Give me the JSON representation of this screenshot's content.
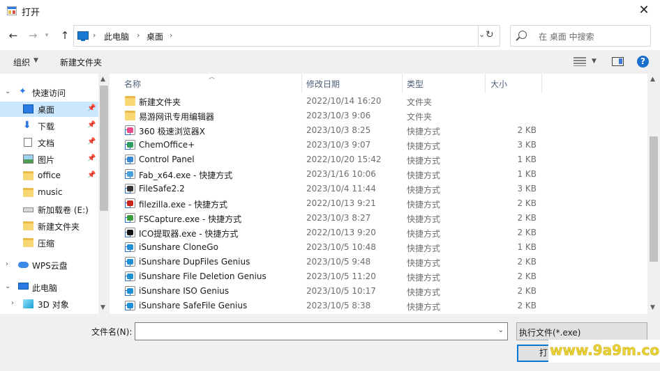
{
  "window": {
    "title": "打开"
  },
  "nav": {
    "crumbs": [
      "此电脑",
      "桌面"
    ],
    "search_placeholder": "在 桌面 中搜索"
  },
  "toolbar": {
    "organize": "组织",
    "new_folder": "新建文件夹"
  },
  "sidebar": {
    "items": [
      {
        "label": "快速访问",
        "icon": "star-icon"
      },
      {
        "label": "桌面",
        "icon": "desktop-icon"
      },
      {
        "label": "下载",
        "icon": "download-icon"
      },
      {
        "label": "文档",
        "icon": "document-icon"
      },
      {
        "label": "图片",
        "icon": "picture-icon"
      },
      {
        "label": "office",
        "icon": "folder-icon"
      },
      {
        "label": "music",
        "icon": "folder-icon"
      },
      {
        "label": "新加载卷 (E:)",
        "icon": "drive-icon"
      },
      {
        "label": "新建文件夹",
        "icon": "folder-icon"
      },
      {
        "label": "压缩",
        "icon": "folder-icon"
      },
      {
        "label": "WPS云盘",
        "icon": "cloud-icon"
      },
      {
        "label": "此电脑",
        "icon": "computer-icon"
      },
      {
        "label": "3D 对象",
        "icon": "3d-objects-icon"
      }
    ]
  },
  "columns": {
    "name": "名称",
    "date": "修改日期",
    "type": "类型",
    "size": "大小"
  },
  "files": [
    {
      "name": "新建文件夹",
      "date": "2022/10/14 16:20",
      "type": "文件夹",
      "size": "",
      "icon": "folder-icon",
      "color": "#f8d775"
    },
    {
      "name": "易游网讯专用编辑器",
      "date": "2023/10/3 9:06",
      "type": "文件夹",
      "size": "",
      "icon": "folder-icon",
      "color": "#f8d775"
    },
    {
      "name": "360 极速浏览器X",
      "date": "2023/10/3 8:25",
      "type": "快捷方式",
      "size": "2 KB",
      "icon": "360-browser-icon",
      "color": "#e94b8a"
    },
    {
      "name": "ChemOffice+",
      "date": "2023/10/3 9:07",
      "type": "快捷方式",
      "size": "3 KB",
      "icon": "chemoffice-icon",
      "color": "#2e9e5e"
    },
    {
      "name": "Control Panel",
      "date": "2022/10/20 15:42",
      "type": "快捷方式",
      "size": "1 KB",
      "icon": "control-panel-icon",
      "color": "#3a86d6"
    },
    {
      "name": "Fab_x64.exe - 快捷方式",
      "date": "2023/1/16 10:06",
      "type": "快捷方式",
      "size": "1 KB",
      "icon": "fab-icon",
      "color": "#4a9fd8"
    },
    {
      "name": "FileSafe2.2",
      "date": "2023/10/4 11:44",
      "type": "快捷方式",
      "size": "3 KB",
      "icon": "filesafe-icon",
      "color": "#333333"
    },
    {
      "name": "filezilla.exe - 快捷方式",
      "date": "2022/10/13 9:21",
      "type": "快捷方式",
      "size": "2 KB",
      "icon": "filezilla-icon",
      "color": "#c9241c"
    },
    {
      "name": "FSCapture.exe - 快捷方式",
      "date": "2023/10/3 8:27",
      "type": "快捷方式",
      "size": "2 KB",
      "icon": "fscapture-icon",
      "color": "#3b9c3b"
    },
    {
      "name": "ICO提取器.exe - 快捷方式",
      "date": "2022/10/13 9:20",
      "type": "快捷方式",
      "size": "2 KB",
      "icon": "ico-extractor-icon",
      "color": "#111111"
    },
    {
      "name": "iSunshare CloneGo",
      "date": "2023/10/5 10:48",
      "type": "快捷方式",
      "size": "1 KB",
      "icon": "isunshare-icon",
      "color": "#1f8fd6"
    },
    {
      "name": "iSunshare DupFiles Genius",
      "date": "2023/10/5 9:48",
      "type": "快捷方式",
      "size": "2 KB",
      "icon": "isunshare-icon",
      "color": "#1f8fd6"
    },
    {
      "name": "iSunshare File Deletion Genius",
      "date": "2023/10/5 11:20",
      "type": "快捷方式",
      "size": "2 KB",
      "icon": "isunshare-icon",
      "color": "#1f8fd6"
    },
    {
      "name": "iSunshare ISO Genius",
      "date": "2023/10/5 10:17",
      "type": "快捷方式",
      "size": "2 KB",
      "icon": "isunshare-icon",
      "color": "#1f8fd6"
    },
    {
      "name": "iSunshare SafeFile Genius",
      "date": "2023/10/5 8:38",
      "type": "快捷方式",
      "size": "2 KB",
      "icon": "isunshare-icon",
      "color": "#1f8fd6"
    }
  ],
  "bottom": {
    "filename_label": "文件名(N):",
    "filename_value": "",
    "filter_label": "执行文件(*.exe)",
    "open_label": "打开"
  },
  "watermark": "www.9a9m.com"
}
